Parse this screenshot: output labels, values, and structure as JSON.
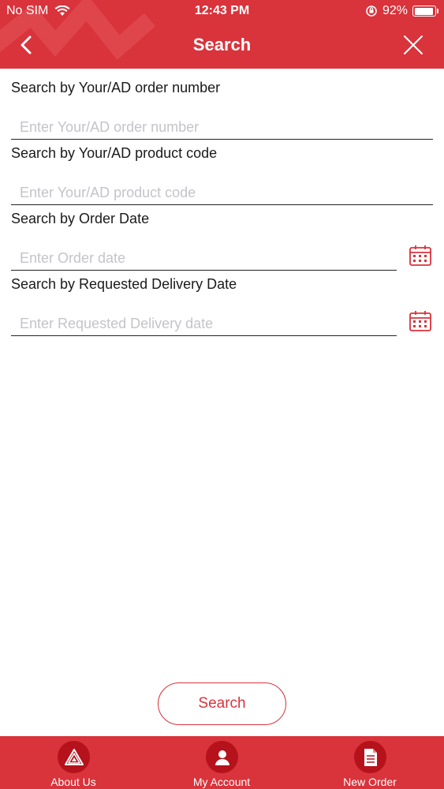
{
  "status_bar": {
    "carrier": "No SIM",
    "time": "12:43 PM",
    "battery": "92%",
    "battery_level": 0.92
  },
  "nav": {
    "title": "Search",
    "back_icon": "chevron-left-icon",
    "close_icon": "close-icon"
  },
  "fields": {
    "order_number": {
      "label": "Search by Your/AD order number",
      "placeholder": "Enter Your/AD order number",
      "value": ""
    },
    "product_code": {
      "label": "Search by Your/AD product code",
      "placeholder": "Enter Your/AD product code",
      "value": ""
    },
    "order_date": {
      "label": "Search by Order Date",
      "placeholder": "Enter Order date",
      "value": "",
      "icon": "calendar-icon"
    },
    "delivery_date": {
      "label": "Search by Requested Delivery Date",
      "placeholder": "Enter Requested Delivery date",
      "value": "",
      "icon": "calendar-icon"
    }
  },
  "search_button": {
    "label": "Search"
  },
  "tabbar": {
    "tabs": [
      {
        "label": "About Us",
        "icon": "logo-icon"
      },
      {
        "label": "My Account",
        "icon": "user-icon"
      },
      {
        "label": "New Order",
        "icon": "document-icon"
      }
    ]
  },
  "colors": {
    "brand_red": "#d9333b",
    "dark_red": "#b5121b"
  }
}
